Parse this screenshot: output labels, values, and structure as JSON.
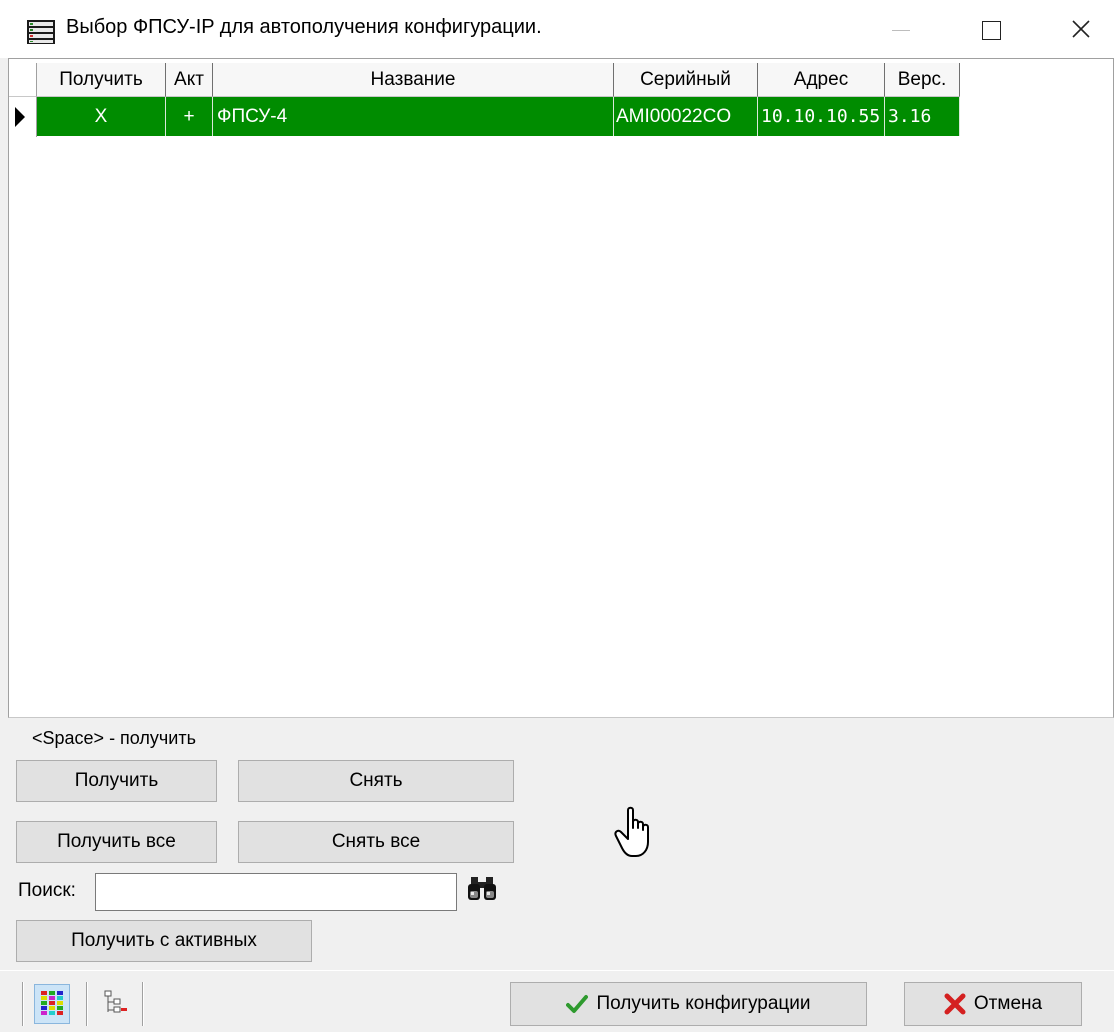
{
  "window": {
    "title": "Выбор ФПСУ-IP для автополучения конфигурации.",
    "icon": "server-list-icon"
  },
  "grid": {
    "columns": [
      "Получить",
      "Акт",
      "Название",
      "Серийный",
      "Адрес",
      "Верс."
    ],
    "rows": [
      {
        "receive": "X",
        "active": "+",
        "name": "ФПСУ-4",
        "serial": "AMI00022CO",
        "address": "10.10.10.55",
        "version": "3.16",
        "selected": true
      }
    ],
    "selected_row_color": "#008c00"
  },
  "hint": "<Space> - получить",
  "buttons": {
    "receive": "Получить",
    "remove": "Снять",
    "receive_all": "Получить все",
    "remove_all": "Снять все",
    "receive_active": "Получить с активных"
  },
  "search": {
    "label": "Поиск:",
    "value": "",
    "icon": "binoculars-icon"
  },
  "footer": {
    "get_config": "Получить конфигурации",
    "cancel": "Отмена",
    "colors": {
      "ok_check": "#2e9a2e",
      "cancel_x": "#d42020"
    }
  }
}
